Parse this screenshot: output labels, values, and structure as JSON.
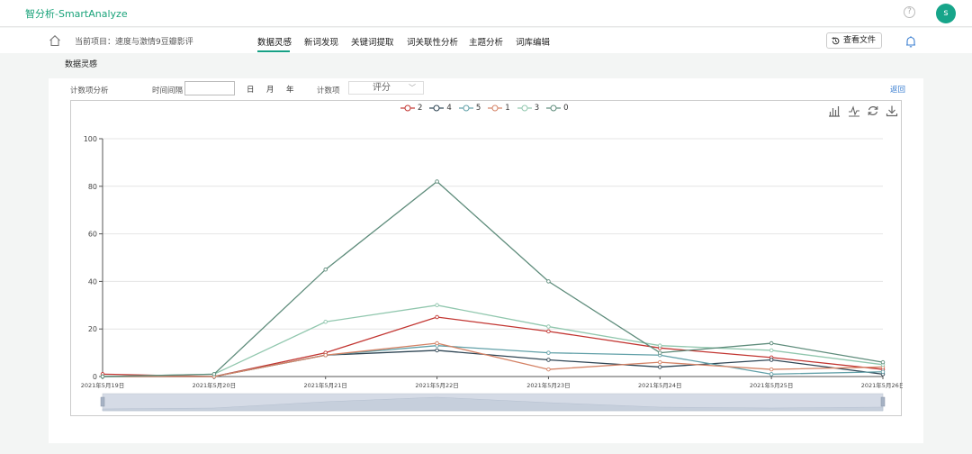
{
  "app": {
    "title": "智分析-SmartAnalyze",
    "user_initial": "s",
    "help_glyph": "?"
  },
  "header": {
    "project": "当前项目：速度与激情9豆瓣影评",
    "tabs": [
      {
        "label": "数据灵感",
        "active": true
      },
      {
        "label": "新词发现",
        "active": false
      },
      {
        "label": "关键词提取",
        "active": false
      },
      {
        "label": "词关联性分析",
        "active": false
      },
      {
        "label": "主题分析",
        "active": false
      },
      {
        "label": "词库编辑",
        "active": false
      }
    ],
    "view_file": "查看文件"
  },
  "section": {
    "title": "数据灵感"
  },
  "controls": {
    "mode": "计数项分析",
    "interval_label": "时间间隔",
    "interval_value": "",
    "units": [
      "日",
      "月",
      "年"
    ],
    "count_label": "计数项",
    "count_select": "评分",
    "back": "返回"
  },
  "chart_data": {
    "type": "line",
    "categories": [
      "2021年5月19日",
      "2021年5月20日",
      "2021年5月21日",
      "2021年5月22日",
      "2021年5月23日",
      "2021年5月24日",
      "2021年5月25日",
      "2021年5月26日"
    ],
    "ylim": [
      0,
      100
    ],
    "yticks": [
      0,
      20,
      40,
      60,
      80,
      100
    ],
    "legend_position": "top-center",
    "series": [
      {
        "name": "2",
        "color": "#c23531",
        "values": [
          1,
          0,
          10,
          25,
          19,
          12,
          8,
          3
        ]
      },
      {
        "name": "4",
        "color": "#2f4554",
        "values": [
          0,
          0,
          9,
          11,
          7,
          4,
          7,
          1
        ]
      },
      {
        "name": "5",
        "color": "#61a0a8",
        "values": [
          0,
          0,
          9,
          13,
          10,
          9,
          1,
          2
        ]
      },
      {
        "name": "1",
        "color": "#d48265",
        "values": [
          0,
          0,
          9,
          14,
          3,
          6,
          3,
          4
        ]
      },
      {
        "name": "3",
        "color": "#91c7ae",
        "values": [
          0,
          1,
          23,
          30,
          21,
          13,
          11,
          5
        ]
      },
      {
        "name": "0",
        "color": "#5e8c7b",
        "values": [
          0,
          1,
          45,
          82,
          40,
          10,
          14,
          6
        ]
      }
    ]
  }
}
